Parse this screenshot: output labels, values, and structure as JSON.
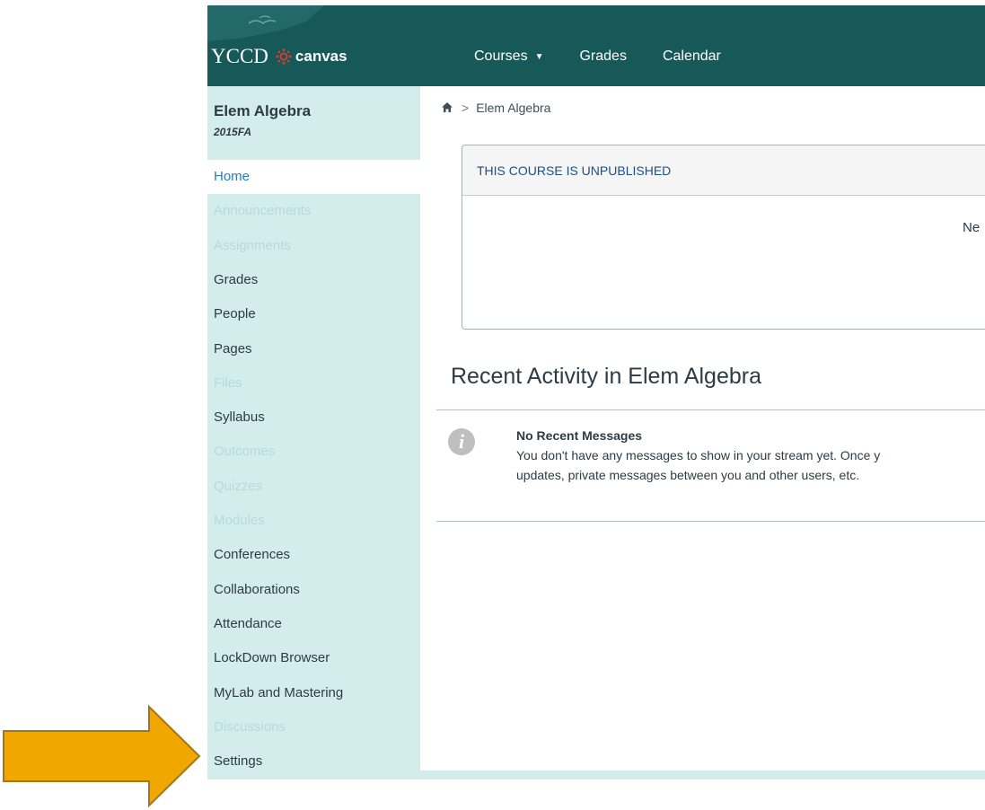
{
  "header": {
    "logo_text": "YCCD",
    "logo_word": "canvas",
    "nav": [
      {
        "label": "Courses",
        "has_dropdown": true
      },
      {
        "label": "Grades"
      },
      {
        "label": "Calendar"
      }
    ]
  },
  "sidebar": {
    "course_name": "Elem Algebra",
    "course_term": "2015FA",
    "items": [
      {
        "label": "Home",
        "state": "active"
      },
      {
        "label": "Announcements",
        "state": "disabled"
      },
      {
        "label": "Assignments",
        "state": "disabled"
      },
      {
        "label": "Grades",
        "state": "enabled"
      },
      {
        "label": "People",
        "state": "enabled"
      },
      {
        "label": "Pages",
        "state": "enabled"
      },
      {
        "label": "Files",
        "state": "disabled"
      },
      {
        "label": "Syllabus",
        "state": "enabled"
      },
      {
        "label": "Outcomes",
        "state": "disabled"
      },
      {
        "label": "Quizzes",
        "state": "disabled"
      },
      {
        "label": "Modules",
        "state": "disabled"
      },
      {
        "label": "Conferences",
        "state": "enabled"
      },
      {
        "label": "Collaborations",
        "state": "enabled"
      },
      {
        "label": "Attendance",
        "state": "enabled"
      },
      {
        "label": "LockDown Browser",
        "state": "enabled"
      },
      {
        "label": "MyLab and Mastering",
        "state": "enabled"
      },
      {
        "label": "Discussions",
        "state": "disabled"
      },
      {
        "label": "Settings",
        "state": "enabled"
      }
    ]
  },
  "main": {
    "breadcrumb": "Elem Algebra",
    "unpublished_banner": "THIS COURSE IS UNPUBLISHED",
    "panel_partial_text": "Ne",
    "recent_title": "Recent Activity in Elem Algebra",
    "message": {
      "title": "No Recent Messages",
      "line1": "You don't have any messages to show in your stream yet. Once y",
      "line2": "updates, private messages between you and other users, etc."
    }
  },
  "colors": {
    "header": "#175959",
    "sidebar": "#d3ecec",
    "active_link": "#2181c3",
    "arrow": "#f0a800",
    "arrow_outline": "#a67612"
  }
}
